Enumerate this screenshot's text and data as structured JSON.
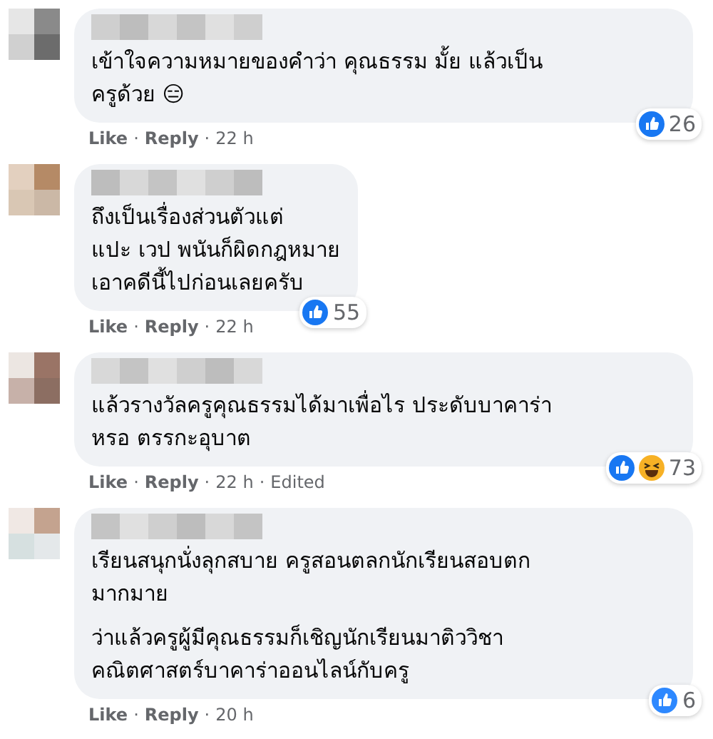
{
  "separator": "·",
  "comments": [
    {
      "paragraphs": [
        [
          "เข้าใจความหมายของคำว่า คุณธรรม มั้ย แล้วเป็น",
          "ครูด้วย 😑"
        ]
      ],
      "reactions": [
        {
          "kind": "like"
        }
      ],
      "reaction_count": "26",
      "like": "Like",
      "reply": "Reply",
      "time": "22 h",
      "wide": true
    },
    {
      "paragraphs": [
        [
          "ถึงเป็นเรื่องส่วนตัวแต่",
          "แปะ เวป พนันก็ผิดกฎหมาย",
          "เอาคดีนี้ไปก่อนเลยครับ"
        ]
      ],
      "reactions": [
        {
          "kind": "like"
        }
      ],
      "reaction_count": "55",
      "like": "Like",
      "reply": "Reply",
      "time": "22 h",
      "wide": false
    },
    {
      "paragraphs": [
        [
          "แล้วรางวัลครูคุณธรรมได้มาเพื่อไร ประดับบาคาร่า",
          "หรอ ตรรกะอุบาต"
        ]
      ],
      "reactions": [
        {
          "kind": "like"
        },
        {
          "kind": "haha"
        }
      ],
      "reaction_count": "73",
      "like": "Like",
      "reply": "Reply",
      "time": "22 h",
      "edited": "Edited",
      "wide": true
    },
    {
      "paragraphs": [
        [
          "เรียนสนุกนั่งลุกสบาย ครูสอนตลกนักเรียนสอบตก",
          "มากมาย"
        ],
        [
          "ว่าแล้วครูผู้มีคุณธรรมก็เชิญนักเรียนมาติววิชา",
          "คณิตศาสตร์บาคาร่าออนไลน์กับครู"
        ]
      ],
      "reactions": [
        {
          "kind": "thumb"
        }
      ],
      "reaction_count": "6",
      "like": "Like",
      "reply": "Reply",
      "time": "20 h",
      "wide": true
    }
  ]
}
